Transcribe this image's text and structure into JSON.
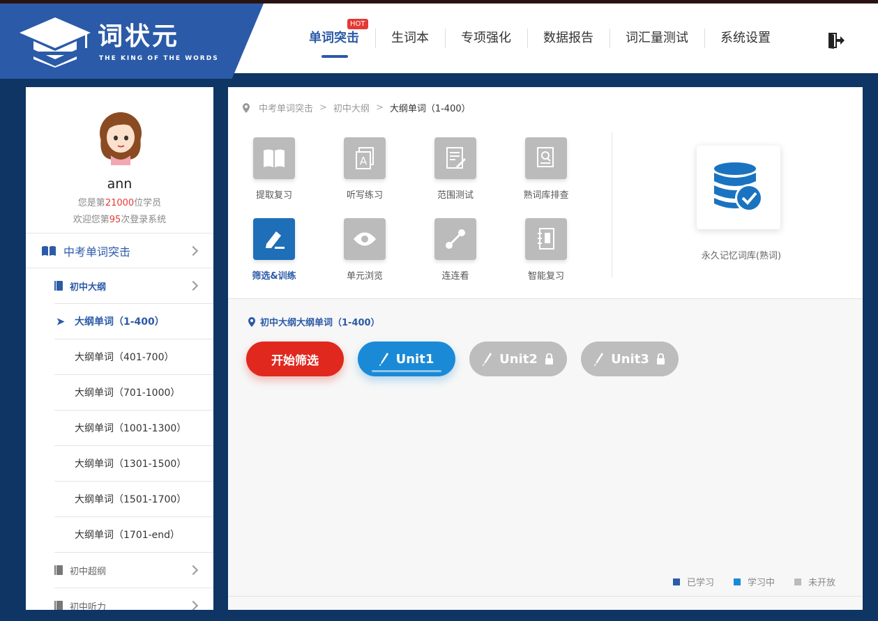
{
  "app": {
    "logo_cn": "词状元",
    "logo_en": "THE KING OF THE WORDS"
  },
  "nav": {
    "items": [
      {
        "label": "单词突击",
        "active": true
      },
      {
        "label": "生词本"
      },
      {
        "label": "专项强化"
      },
      {
        "label": "数据报告"
      },
      {
        "label": "词汇量测试"
      },
      {
        "label": "系统设置"
      }
    ],
    "hot_badge": "HOT",
    "exit_icon": "exit-icon"
  },
  "user": {
    "name": "ann",
    "rank_prefix": "您是第",
    "rank_value": "21000",
    "rank_suffix": "位学员",
    "login_prefix": "欢迎您第",
    "login_value": "95",
    "login_suffix": "次登录系统"
  },
  "sidebar": {
    "top_item": "中考单词突击",
    "sections": [
      {
        "label": "初中大纲"
      },
      {
        "label": "初中超纲"
      },
      {
        "label": "初中听力"
      }
    ],
    "items": [
      {
        "label": "大纲单词（1-400）",
        "active": true
      },
      {
        "label": "大纲单词（401-700）"
      },
      {
        "label": "大纲单词（701-1000）"
      },
      {
        "label": "大纲单词（1001-1300）"
      },
      {
        "label": "大纲单词（1301-1500）"
      },
      {
        "label": "大纲单词（1501-1700）"
      },
      {
        "label": "大纲单词（1701-end）"
      }
    ]
  },
  "breadcrumb": [
    "中考单词突击",
    "初中大纲",
    "大纲单词（1-400）"
  ],
  "tools": [
    {
      "label": "提取复习",
      "icon": "book-open-icon"
    },
    {
      "label": "听写练习",
      "icon": "letter-card-icon"
    },
    {
      "label": "范围测试",
      "icon": "test-paper-icon"
    },
    {
      "label": "熟词库排查",
      "icon": "search-doc-icon"
    },
    {
      "label": "筛选&训练",
      "icon": "pencil-icon",
      "active": true
    },
    {
      "label": "单元浏览",
      "icon": "eye-icon"
    },
    {
      "label": "连连看",
      "icon": "link-icon"
    },
    {
      "label": "智能复习",
      "icon": "notebook-icon"
    }
  ],
  "vocab_db": {
    "label": "永久记忆词库(熟词)",
    "icon": "database-check-icon"
  },
  "section_title": "初中大纲大纲单词（1-400）",
  "start_button": "开始筛选",
  "units": [
    {
      "label": "Unit1",
      "status": "learning"
    },
    {
      "label": "Unit2",
      "status": "locked"
    },
    {
      "label": "Unit3",
      "status": "locked"
    }
  ],
  "legend": [
    {
      "label": "已学习",
      "color": "#2b5aa8"
    },
    {
      "label": "学习中",
      "color": "#1a8ad6"
    },
    {
      "label": "未开放",
      "color": "#bbbbbb"
    }
  ]
}
